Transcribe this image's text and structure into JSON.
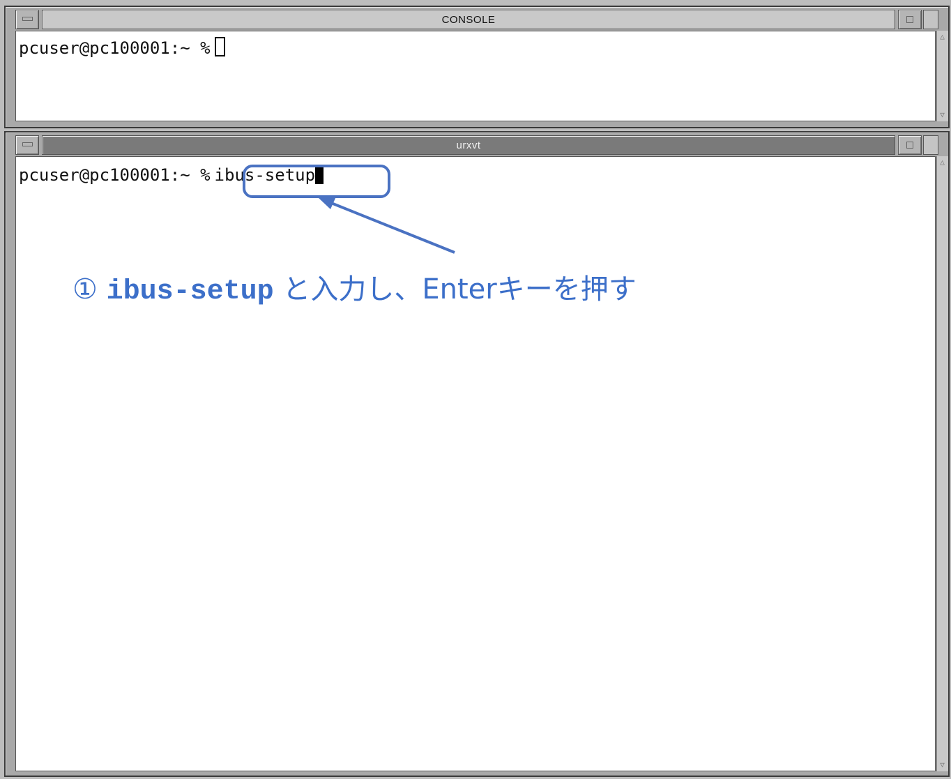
{
  "windows": {
    "console": {
      "title": "CONSOLE",
      "prompt": "pcuser@pc100001:~ %"
    },
    "urxvt": {
      "title": "urxvt",
      "prompt": "pcuser@pc100001:~ %",
      "command": "ibus-setup"
    }
  },
  "annotation": {
    "number": "①",
    "command": "ibus-setup",
    "text": "と入力し、Enterキーを押す"
  },
  "colors": {
    "annotation": "#3c6fc9",
    "highlight": "#4a72c2"
  },
  "icons": {
    "minimize": "minimize-icon",
    "maximize": "maximize-icon",
    "scroll_up": "scroll-up-icon",
    "scroll_down": "scroll-down-icon"
  }
}
